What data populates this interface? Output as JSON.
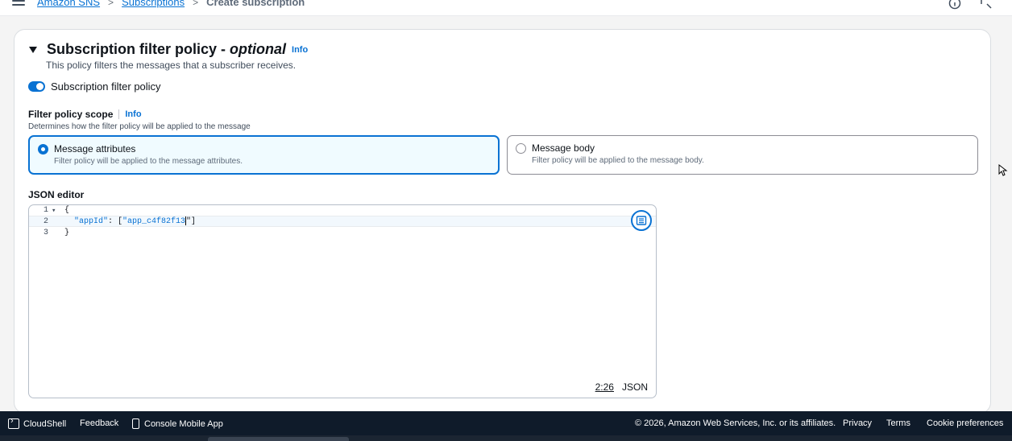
{
  "breadcrumb": {
    "items": [
      "Amazon SNS",
      "Subscriptions"
    ],
    "current": "Create subscription",
    "separator": ">"
  },
  "section": {
    "title_prefix": "Subscription filter policy - ",
    "title_optional": "optional",
    "info": "Info",
    "description": "This policy filters the messages that a subscriber receives."
  },
  "toggle": {
    "label": "Subscription filter policy",
    "on": true
  },
  "scope": {
    "label": "Filter policy scope",
    "info": "Info",
    "description": "Determines how the filter policy will be applied to the message",
    "options": [
      {
        "title": "Message attributes",
        "description": "Filter policy will be applied to the message attributes.",
        "selected": true
      },
      {
        "title": "Message body",
        "description": "Filter policy will be applied to the message body.",
        "selected": false
      }
    ]
  },
  "editor": {
    "label": "JSON editor",
    "lines": [
      {
        "number": "1",
        "fold": "▾",
        "text": "{"
      },
      {
        "number": "2",
        "key": "\"appId\"",
        "colon": ": [",
        "value": "\"app_c4f82f13",
        "after_cursor": "\"]"
      },
      {
        "number": "3",
        "text": "}"
      }
    ],
    "cursor_position": "2:26",
    "language": "JSON"
  },
  "footer": {
    "cloudshell": "CloudShell",
    "feedback": "Feedback",
    "mobile_app": "Console Mobile App",
    "copyright": "© 2026, Amazon Web Services, Inc. or its affiliates.",
    "privacy": "Privacy",
    "terms": "Terms",
    "cookie": "Cookie preferences"
  },
  "colors": {
    "accent": "#0972d3",
    "footer_bg": "#0f1b2a"
  }
}
